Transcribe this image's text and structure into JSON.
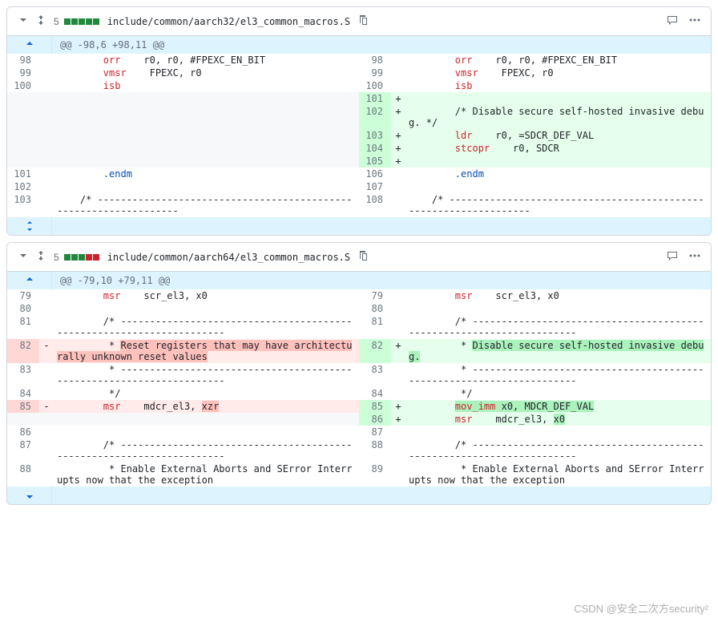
{
  "files": [
    {
      "changes": "5",
      "blocks": [
        "add",
        "add",
        "add",
        "add",
        "add"
      ],
      "path": "include/common/aarch32/el3_common_macros.S",
      "hunk_header_top": "@@ -98,6 +98,11 @@",
      "left": [
        {
          "n": "98",
          "t": "ctx",
          "code": "\t\torr\tr0, r0, #FPEXC_EN_BIT"
        },
        {
          "n": "99",
          "t": "ctx",
          "code": "\t\tvmsr\tFPEXC, r0"
        },
        {
          "n": "100",
          "t": "ctx",
          "code": "\t\tisb"
        },
        {
          "n": "",
          "t": "empty",
          "code": ""
        },
        {
          "n": "",
          "t": "empty",
          "code": ""
        },
        {
          "n": "",
          "t": "empty",
          "code": ""
        },
        {
          "n": "",
          "t": "empty",
          "code": ""
        },
        {
          "n": "",
          "t": "empty",
          "code": ""
        },
        {
          "n": "101",
          "t": "ctx",
          "code": "\t\t.endm"
        },
        {
          "n": "102",
          "t": "ctx",
          "code": ""
        },
        {
          "n": "103",
          "t": "ctx",
          "code": "\t/* -----------------------------------------------------------------"
        }
      ],
      "right": [
        {
          "n": "98",
          "t": "ctx",
          "code": "\t\torr\tr0, r0, #FPEXC_EN_BIT"
        },
        {
          "n": "99",
          "t": "ctx",
          "code": "\t\tvmsr\tFPEXC, r0"
        },
        {
          "n": "100",
          "t": "ctx",
          "code": "\t\tisb"
        },
        {
          "n": "101",
          "t": "add",
          "code": ""
        },
        {
          "n": "102",
          "t": "add",
          "code": "\t\t/* Disable secure self-hosted invasive debug. */"
        },
        {
          "n": "103",
          "t": "add",
          "code": "\t\tldr\tr0, =SDCR_DEF_VAL"
        },
        {
          "n": "104",
          "t": "add",
          "code": "\t\tstcopr\tr0, SDCR"
        },
        {
          "n": "105",
          "t": "add",
          "code": ""
        },
        {
          "n": "106",
          "t": "ctx",
          "code": "\t\t.endm"
        },
        {
          "n": "107",
          "t": "ctx",
          "code": ""
        },
        {
          "n": "108",
          "t": "ctx",
          "code": "\t/* -----------------------------------------------------------------"
        }
      ]
    },
    {
      "changes": "5",
      "blocks": [
        "add",
        "add",
        "add",
        "del",
        "del"
      ],
      "path": "include/common/aarch64/el3_common_macros.S",
      "hunk_header_top": "@@ -79,10 +79,11 @@",
      "left": [
        {
          "n": "79",
          "t": "ctx",
          "code": "\t\tmsr\tscr_el3, x0"
        },
        {
          "n": "80",
          "t": "ctx",
          "code": ""
        },
        {
          "n": "81",
          "t": "ctx",
          "code": "\t\t/* ---------------------------------------------------------------------"
        },
        {
          "n": "82",
          "sign": "-",
          "t": "del",
          "code": "\t\t * <HLD>Reset registers that may have architecturally unknown reset values</HLD>"
        },
        {
          "n": "83",
          "t": "ctx",
          "code": "\t\t * ---------------------------------------------------------------------"
        },
        {
          "n": "84",
          "t": "ctx",
          "code": "\t\t */"
        },
        {
          "n": "85",
          "sign": "-",
          "t": "del",
          "code": "\t\tmsr\tmdcr_el3, <HLD>xzr</HLD>"
        },
        {
          "n": "",
          "t": "empty",
          "code": ""
        },
        {
          "n": "86",
          "t": "ctx",
          "code": ""
        },
        {
          "n": "87",
          "t": "ctx",
          "code": "\t\t/* ---------------------------------------------------------------------"
        },
        {
          "n": "88",
          "t": "ctx",
          "code": "\t\t * Enable External Aborts and SError Interrupts now that the exception"
        }
      ],
      "right": [
        {
          "n": "79",
          "t": "ctx",
          "code": "\t\tmsr\tscr_el3, x0"
        },
        {
          "n": "80",
          "t": "ctx",
          "code": ""
        },
        {
          "n": "81",
          "t": "ctx",
          "code": "\t\t/* ---------------------------------------------------------------------"
        },
        {
          "n": "82",
          "sign": "+",
          "t": "add",
          "code": "\t\t * <HLA>Disable secure self-hosted invasive debug.</HLA>"
        },
        {
          "n": "83",
          "t": "ctx",
          "code": "\t\t * ---------------------------------------------------------------------"
        },
        {
          "n": "84",
          "t": "ctx",
          "code": "\t\t */"
        },
        {
          "n": "85",
          "sign": "+",
          "t": "add",
          "code": "\t\t<HLA>mov_imm x0, MDCR_DEF_VAL</HLA>"
        },
        {
          "n": "86",
          "sign": "+",
          "t": "add",
          "code": "\t\tmsr\tmdcr_el3, <HLA>x0</HLA>"
        },
        {
          "n": "87",
          "t": "ctx",
          "code": ""
        },
        {
          "n": "88",
          "t": "ctx",
          "code": "\t\t/* ---------------------------------------------------------------------"
        },
        {
          "n": "89",
          "t": "ctx",
          "code": "\t\t * Enable External Aborts and SError Interrupts now that the exception"
        }
      ]
    }
  ],
  "watermark": "CSDN @安全二次方security²",
  "syntax_keywords": [
    "orr",
    "vmsr",
    "isb",
    "ldr",
    "stcopr",
    "msr",
    "mov_imm"
  ],
  "syntax_special": [
    ".endm"
  ]
}
